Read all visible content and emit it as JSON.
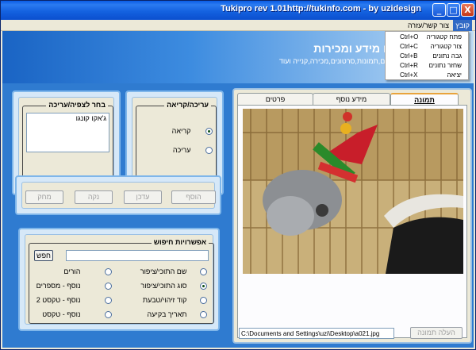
{
  "window": {
    "title": "Tukipro rev 1.01http://tukinfo.com - by uzidesign",
    "minimize": "_",
    "maximize": "□",
    "close": "X"
  },
  "menu": {
    "file": "קובץ",
    "help": "צור קשר/עזרה"
  },
  "file_menu": {
    "items": [
      {
        "label": "פתח קטגוריה",
        "shortcut": "Ctrl+O"
      },
      {
        "label": "צור קטגוריה",
        "shortcut": "Ctrl+C"
      },
      {
        "label": "גבה נתונים",
        "shortcut": "Ctrl+B"
      },
      {
        "label": "שחזר נתונים",
        "shortcut": "Ctrl+R"
      },
      {
        "label": "יציאה",
        "shortcut": "Ctrl+X"
      }
    ]
  },
  "banner": {
    "title": "ים מידע ומכירות",
    "subtitle": "ים,תמונות,סרטונים,מכירה,קנייה ועוד..."
  },
  "mode_group": {
    "label": "עריכה/קריאה",
    "read": "קריאה",
    "edit": "עריכה"
  },
  "selection_group": {
    "label": "בחר לצפיה/עריכה",
    "items": [
      "ג'אקו קונגו"
    ]
  },
  "actions": {
    "add": "הוסף",
    "update": "עדכן",
    "clear": "נקה",
    "delete": "מחק"
  },
  "search": {
    "label": "אפשרויות חיפוש",
    "button": "חפש",
    "input_value": "",
    "options": [
      {
        "label": "שם התוכי/ציפור",
        "checked": false
      },
      {
        "label": "סוג התוכי/ציפור",
        "checked": true
      },
      {
        "label": "קוד זיהוי/טבעת",
        "checked": false
      },
      {
        "label": "תאריך בקיעה",
        "checked": false
      },
      {
        "label": "הורים",
        "checked": false
      },
      {
        "label": "נוסף - מספרים",
        "checked": false
      },
      {
        "label": "נוסף - טקסט 2",
        "checked": false
      },
      {
        "label": "נוסף - טקסט",
        "checked": false
      }
    ]
  },
  "tabs": [
    {
      "label": "תמונה",
      "active": true
    },
    {
      "label": "מידע נוסף",
      "active": false
    },
    {
      "label": "פרטים",
      "active": false
    }
  ],
  "image_panel": {
    "path": "C:\\Documents and Settings\\uzi\\Desktop\\a021.jpg",
    "upload_button": "העלה תמונה"
  },
  "colors": {
    "title_bar": "#0a5ce6",
    "panel_border": "#7fb6ea",
    "content_bg": "#2f7bd0"
  }
}
